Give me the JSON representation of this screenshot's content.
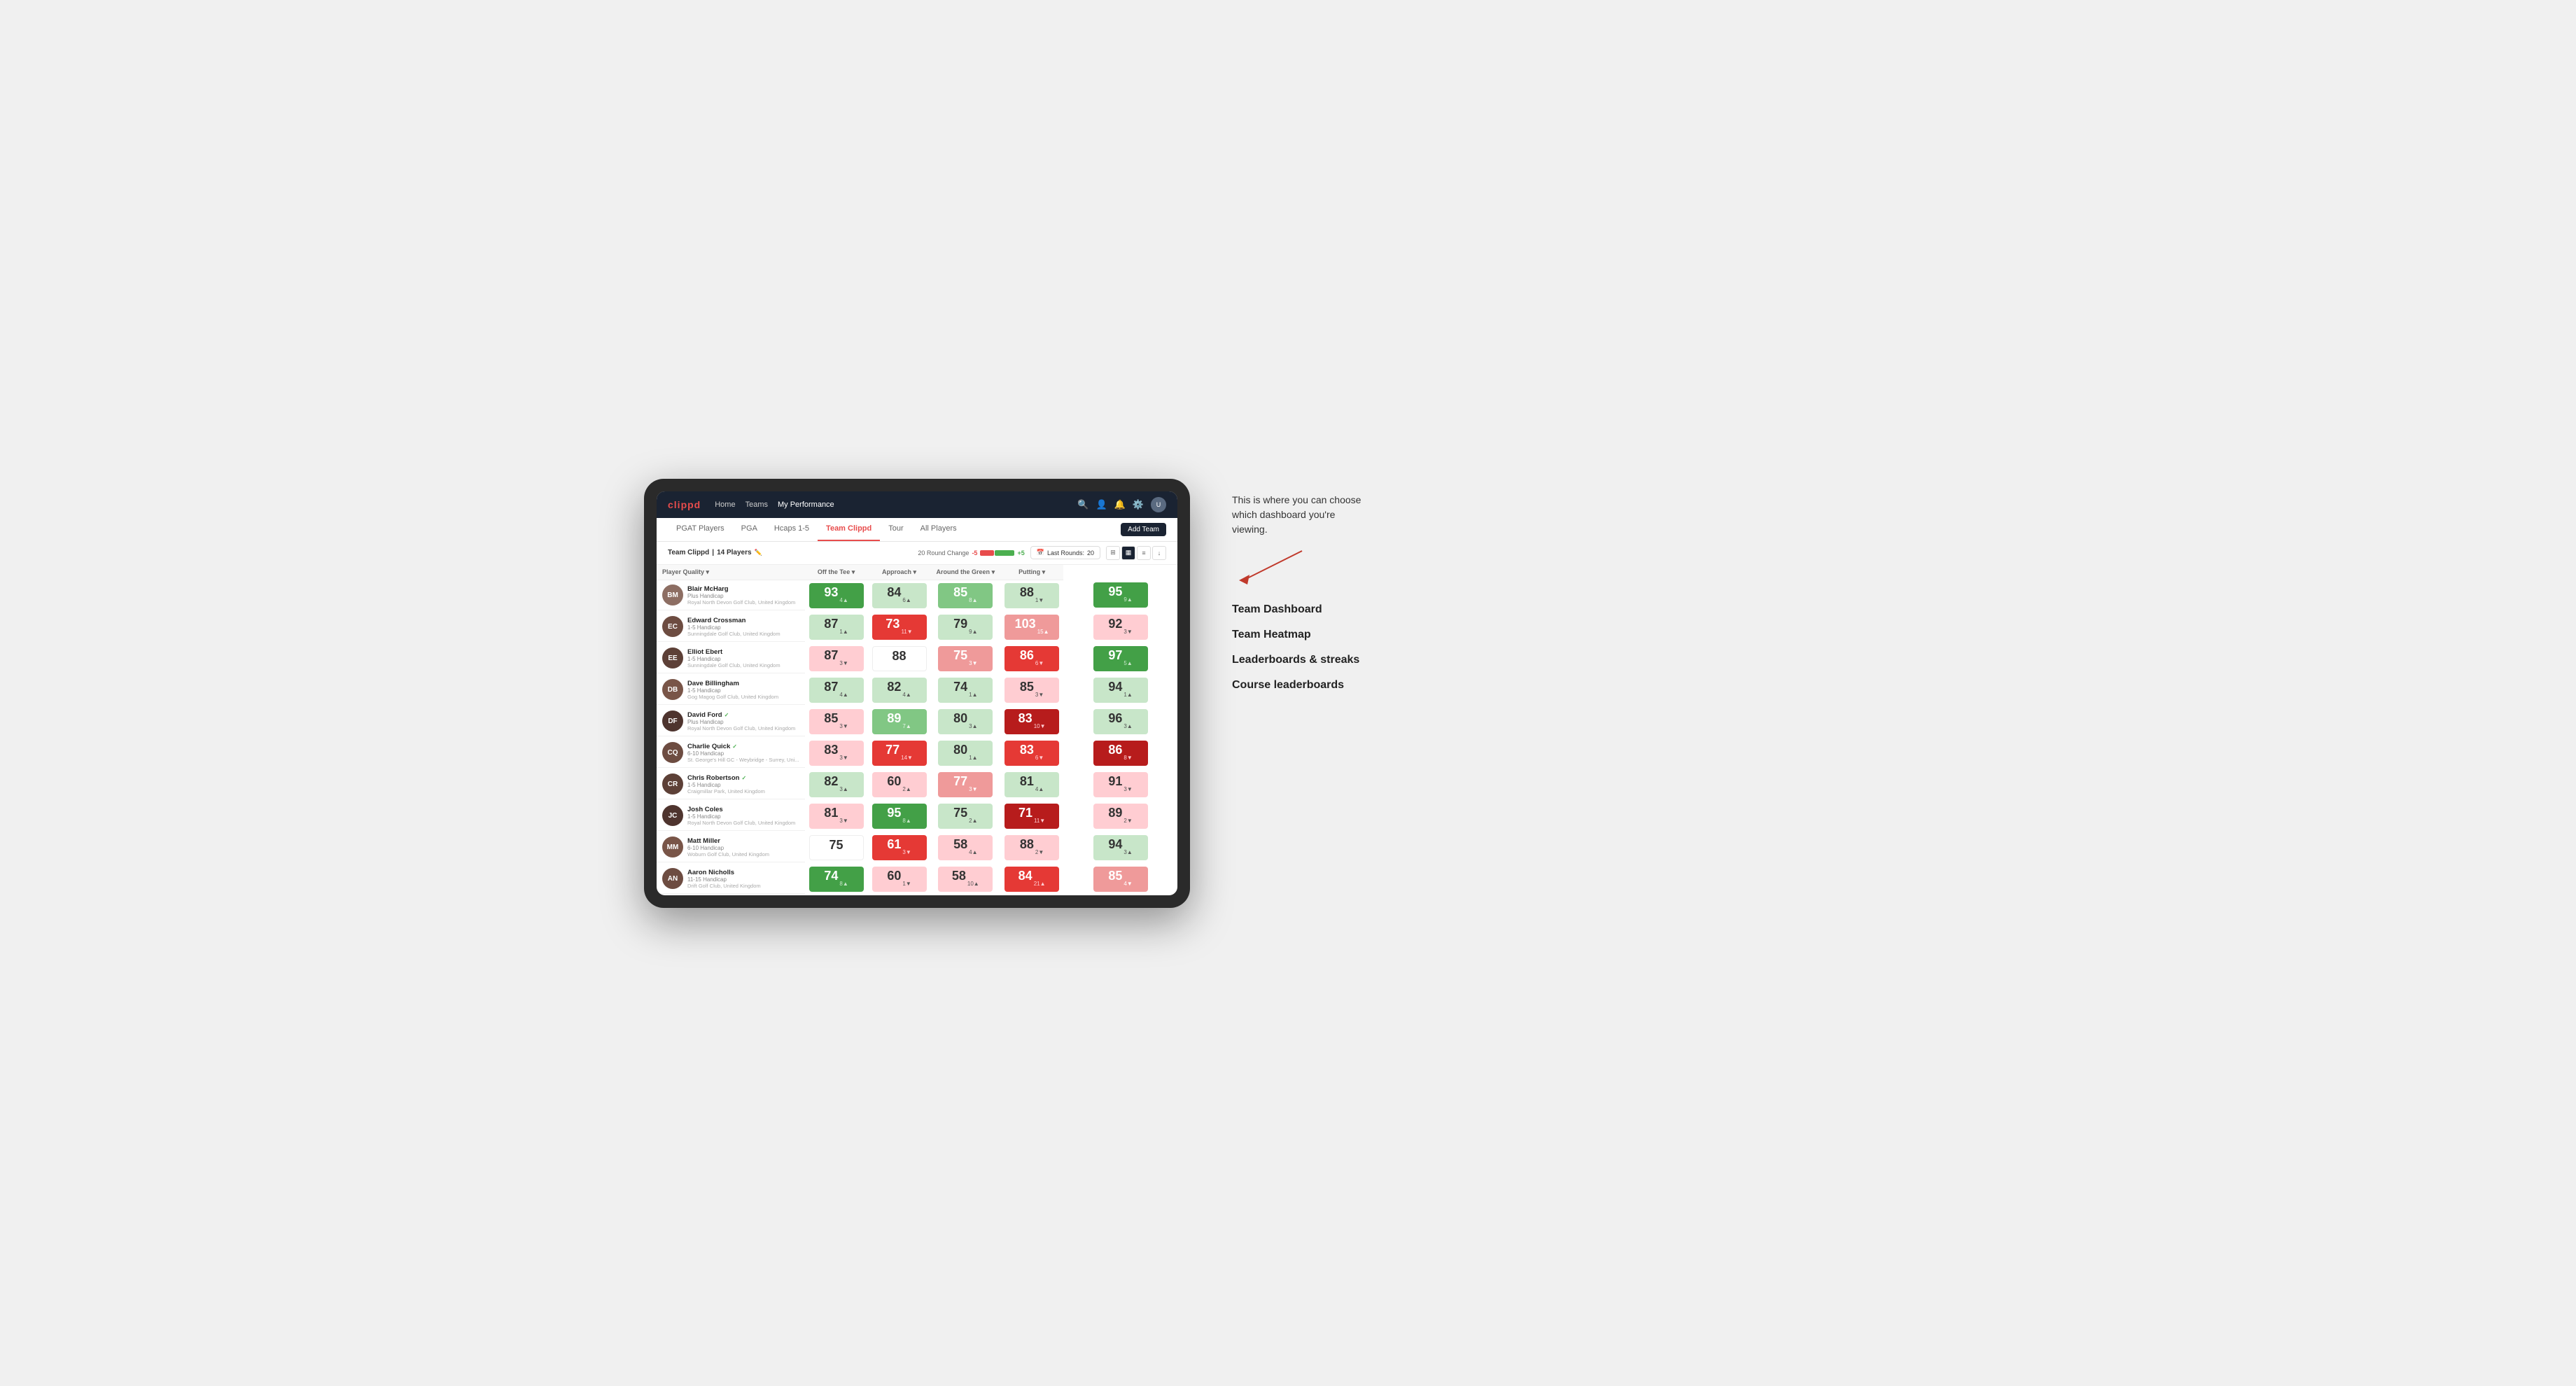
{
  "annotation": {
    "intro": "This is where you can choose which dashboard you're viewing.",
    "options": [
      "Team Dashboard",
      "Team Heatmap",
      "Leaderboards & streaks",
      "Course leaderboards"
    ]
  },
  "navbar": {
    "logo": "clippd",
    "links": [
      "Home",
      "Teams",
      "My Performance"
    ],
    "active_link": "My Performance"
  },
  "tabs": {
    "items": [
      "PGAT Players",
      "PGA",
      "Hcaps 1-5",
      "Team Clippd",
      "Tour",
      "All Players"
    ],
    "active": "Team Clippd",
    "add_team_label": "Add Team"
  },
  "subheader": {
    "team_name": "Team Clippd",
    "player_count": "14 Players",
    "round_change_label": "20 Round Change",
    "round_change_neg": "-5",
    "round_change_pos": "+5",
    "last_rounds_label": "Last Rounds:",
    "last_rounds_value": "20"
  },
  "columns": {
    "player": "Player Quality",
    "off_tee": "Off the Tee",
    "approach": "Approach",
    "around_green": "Around the Green",
    "putting": "Putting"
  },
  "players": [
    {
      "name": "Blair McHarg",
      "handicap": "Plus Handicap",
      "club": "Royal North Devon Golf Club, United Kingdom",
      "initials": "BM",
      "avatar_class": "av-blair",
      "scores": {
        "quality": {
          "value": "93",
          "change": "4",
          "dir": "up",
          "bg": "bg-green-med"
        },
        "off_tee": {
          "value": "84",
          "change": "6",
          "dir": "up",
          "bg": "bg-green-pale"
        },
        "approach": {
          "value": "85",
          "change": "8",
          "dir": "up",
          "bg": "bg-green-light"
        },
        "around_green": {
          "value": "88",
          "change": "1",
          "dir": "down",
          "bg": "bg-green-pale"
        },
        "putting": {
          "value": "95",
          "change": "9",
          "dir": "up",
          "bg": "bg-green-med"
        }
      }
    },
    {
      "name": "Edward Crossman",
      "handicap": "1-5 Handicap",
      "club": "Sunningdale Golf Club, United Kingdom",
      "initials": "EC",
      "avatar_class": "av-edward",
      "scores": {
        "quality": {
          "value": "87",
          "change": "1",
          "dir": "up",
          "bg": "bg-green-pale"
        },
        "off_tee": {
          "value": "73",
          "change": "11",
          "dir": "down",
          "bg": "bg-red-med"
        },
        "approach": {
          "value": "79",
          "change": "9",
          "dir": "up",
          "bg": "bg-green-pale"
        },
        "around_green": {
          "value": "103",
          "change": "15",
          "dir": "up",
          "bg": "bg-red-light"
        },
        "putting": {
          "value": "92",
          "change": "3",
          "dir": "down",
          "bg": "bg-red-pale"
        }
      }
    },
    {
      "name": "Elliot Ebert",
      "handicap": "1-5 Handicap",
      "club": "Sunningdale Golf Club, United Kingdom",
      "initials": "EE",
      "avatar_class": "av-elliot",
      "scores": {
        "quality": {
          "value": "87",
          "change": "3",
          "dir": "down",
          "bg": "bg-red-pale"
        },
        "off_tee": {
          "value": "88",
          "change": "",
          "dir": "",
          "bg": "bg-white"
        },
        "approach": {
          "value": "75",
          "change": "3",
          "dir": "down",
          "bg": "bg-red-light"
        },
        "around_green": {
          "value": "86",
          "change": "6",
          "dir": "down",
          "bg": "bg-red-med"
        },
        "putting": {
          "value": "97",
          "change": "5",
          "dir": "up",
          "bg": "bg-green-med"
        }
      }
    },
    {
      "name": "Dave Billingham",
      "handicap": "1-5 Handicap",
      "club": "Gog Magog Golf Club, United Kingdom",
      "initials": "DB",
      "avatar_class": "av-dave",
      "scores": {
        "quality": {
          "value": "87",
          "change": "4",
          "dir": "up",
          "bg": "bg-green-pale"
        },
        "off_tee": {
          "value": "82",
          "change": "4",
          "dir": "up",
          "bg": "bg-green-pale"
        },
        "approach": {
          "value": "74",
          "change": "1",
          "dir": "up",
          "bg": "bg-green-pale"
        },
        "around_green": {
          "value": "85",
          "change": "3",
          "dir": "down",
          "bg": "bg-red-pale"
        },
        "putting": {
          "value": "94",
          "change": "1",
          "dir": "up",
          "bg": "bg-green-pale"
        }
      }
    },
    {
      "name": "David Ford",
      "handicap": "Plus Handicap",
      "club": "Royal North Devon Golf Club, United Kingdom",
      "initials": "DF",
      "avatar_class": "av-david",
      "verified": true,
      "scores": {
        "quality": {
          "value": "85",
          "change": "3",
          "dir": "down",
          "bg": "bg-red-pale"
        },
        "off_tee": {
          "value": "89",
          "change": "7",
          "dir": "up",
          "bg": "bg-green-light"
        },
        "approach": {
          "value": "80",
          "change": "3",
          "dir": "up",
          "bg": "bg-green-pale"
        },
        "around_green": {
          "value": "83",
          "change": "10",
          "dir": "down",
          "bg": "bg-red-dark"
        },
        "putting": {
          "value": "96",
          "change": "3",
          "dir": "up",
          "bg": "bg-green-pale"
        }
      }
    },
    {
      "name": "Charlie Quick",
      "handicap": "6-10 Handicap",
      "club": "St. George's Hill GC - Weybridge - Surrey, Uni...",
      "initials": "CQ",
      "avatar_class": "av-charlie",
      "verified": true,
      "scores": {
        "quality": {
          "value": "83",
          "change": "3",
          "dir": "down",
          "bg": "bg-red-pale"
        },
        "off_tee": {
          "value": "77",
          "change": "14",
          "dir": "down",
          "bg": "bg-red-med"
        },
        "approach": {
          "value": "80",
          "change": "1",
          "dir": "up",
          "bg": "bg-green-pale"
        },
        "around_green": {
          "value": "83",
          "change": "6",
          "dir": "down",
          "bg": "bg-red-med"
        },
        "putting": {
          "value": "86",
          "change": "8",
          "dir": "down",
          "bg": "bg-red-dark"
        }
      }
    },
    {
      "name": "Chris Robertson",
      "handicap": "1-5 Handicap",
      "club": "Craigmillar Park, United Kingdom",
      "initials": "CR",
      "avatar_class": "av-chris",
      "verified": true,
      "scores": {
        "quality": {
          "value": "82",
          "change": "3",
          "dir": "up",
          "bg": "bg-green-pale"
        },
        "off_tee": {
          "value": "60",
          "change": "2",
          "dir": "up",
          "bg": "bg-red-pale"
        },
        "approach": {
          "value": "77",
          "change": "3",
          "dir": "down",
          "bg": "bg-red-light"
        },
        "around_green": {
          "value": "81",
          "change": "4",
          "dir": "up",
          "bg": "bg-green-pale"
        },
        "putting": {
          "value": "91",
          "change": "3",
          "dir": "down",
          "bg": "bg-red-pale"
        }
      }
    },
    {
      "name": "Josh Coles",
      "handicap": "1-5 Handicap",
      "club": "Royal North Devon Golf Club, United Kingdom",
      "initials": "JC",
      "avatar_class": "av-josh",
      "scores": {
        "quality": {
          "value": "81",
          "change": "3",
          "dir": "down",
          "bg": "bg-red-pale"
        },
        "off_tee": {
          "value": "95",
          "change": "8",
          "dir": "up",
          "bg": "bg-green-med"
        },
        "approach": {
          "value": "75",
          "change": "2",
          "dir": "up",
          "bg": "bg-green-pale"
        },
        "around_green": {
          "value": "71",
          "change": "11",
          "dir": "down",
          "bg": "bg-red-dark"
        },
        "putting": {
          "value": "89",
          "change": "2",
          "dir": "down",
          "bg": "bg-red-pale"
        }
      }
    },
    {
      "name": "Matt Miller",
      "handicap": "6-10 Handicap",
      "club": "Woburn Golf Club, United Kingdom",
      "initials": "MM",
      "avatar_class": "av-matt",
      "scores": {
        "quality": {
          "value": "75",
          "change": "",
          "dir": "",
          "bg": "bg-white"
        },
        "off_tee": {
          "value": "61",
          "change": "3",
          "dir": "down",
          "bg": "bg-red-med"
        },
        "approach": {
          "value": "58",
          "change": "4",
          "dir": "up",
          "bg": "bg-red-pale"
        },
        "around_green": {
          "value": "88",
          "change": "2",
          "dir": "down",
          "bg": "bg-red-pale"
        },
        "putting": {
          "value": "94",
          "change": "3",
          "dir": "up",
          "bg": "bg-green-pale"
        }
      }
    },
    {
      "name": "Aaron Nicholls",
      "handicap": "11-15 Handicap",
      "club": "Drift Golf Club, United Kingdom",
      "initials": "AN",
      "avatar_class": "av-aaron",
      "scores": {
        "quality": {
          "value": "74",
          "change": "8",
          "dir": "up",
          "bg": "bg-green-med"
        },
        "off_tee": {
          "value": "60",
          "change": "1",
          "dir": "down",
          "bg": "bg-red-pale"
        },
        "approach": {
          "value": "58",
          "change": "10",
          "dir": "up",
          "bg": "bg-red-pale"
        },
        "around_green": {
          "value": "84",
          "change": "21",
          "dir": "up",
          "bg": "bg-red-med"
        },
        "putting": {
          "value": "85",
          "change": "4",
          "dir": "down",
          "bg": "bg-red-light"
        }
      }
    }
  ]
}
